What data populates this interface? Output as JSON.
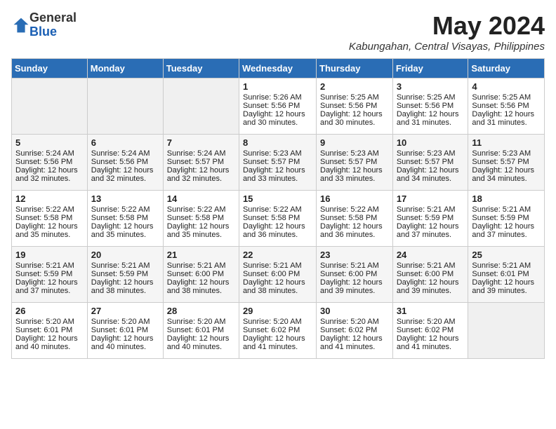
{
  "logo": {
    "general": "General",
    "blue": "Blue"
  },
  "title": "May 2024",
  "location": "Kabungahan, Central Visayas, Philippines",
  "days_header": [
    "Sunday",
    "Monday",
    "Tuesday",
    "Wednesday",
    "Thursday",
    "Friday",
    "Saturday"
  ],
  "weeks": [
    [
      {
        "day": "",
        "info": ""
      },
      {
        "day": "",
        "info": ""
      },
      {
        "day": "",
        "info": ""
      },
      {
        "day": "1",
        "info": "Sunrise: 5:26 AM\nSunset: 5:56 PM\nDaylight: 12 hours\nand 30 minutes."
      },
      {
        "day": "2",
        "info": "Sunrise: 5:25 AM\nSunset: 5:56 PM\nDaylight: 12 hours\nand 30 minutes."
      },
      {
        "day": "3",
        "info": "Sunrise: 5:25 AM\nSunset: 5:56 PM\nDaylight: 12 hours\nand 31 minutes."
      },
      {
        "day": "4",
        "info": "Sunrise: 5:25 AM\nSunset: 5:56 PM\nDaylight: 12 hours\nand 31 minutes."
      }
    ],
    [
      {
        "day": "5",
        "info": "Sunrise: 5:24 AM\nSunset: 5:56 PM\nDaylight: 12 hours\nand 32 minutes."
      },
      {
        "day": "6",
        "info": "Sunrise: 5:24 AM\nSunset: 5:56 PM\nDaylight: 12 hours\nand 32 minutes."
      },
      {
        "day": "7",
        "info": "Sunrise: 5:24 AM\nSunset: 5:57 PM\nDaylight: 12 hours\nand 32 minutes."
      },
      {
        "day": "8",
        "info": "Sunrise: 5:23 AM\nSunset: 5:57 PM\nDaylight: 12 hours\nand 33 minutes."
      },
      {
        "day": "9",
        "info": "Sunrise: 5:23 AM\nSunset: 5:57 PM\nDaylight: 12 hours\nand 33 minutes."
      },
      {
        "day": "10",
        "info": "Sunrise: 5:23 AM\nSunset: 5:57 PM\nDaylight: 12 hours\nand 34 minutes."
      },
      {
        "day": "11",
        "info": "Sunrise: 5:23 AM\nSunset: 5:57 PM\nDaylight: 12 hours\nand 34 minutes."
      }
    ],
    [
      {
        "day": "12",
        "info": "Sunrise: 5:22 AM\nSunset: 5:58 PM\nDaylight: 12 hours\nand 35 minutes."
      },
      {
        "day": "13",
        "info": "Sunrise: 5:22 AM\nSunset: 5:58 PM\nDaylight: 12 hours\nand 35 minutes."
      },
      {
        "day": "14",
        "info": "Sunrise: 5:22 AM\nSunset: 5:58 PM\nDaylight: 12 hours\nand 35 minutes."
      },
      {
        "day": "15",
        "info": "Sunrise: 5:22 AM\nSunset: 5:58 PM\nDaylight: 12 hours\nand 36 minutes."
      },
      {
        "day": "16",
        "info": "Sunrise: 5:22 AM\nSunset: 5:58 PM\nDaylight: 12 hours\nand 36 minutes."
      },
      {
        "day": "17",
        "info": "Sunrise: 5:21 AM\nSunset: 5:59 PM\nDaylight: 12 hours\nand 37 minutes."
      },
      {
        "day": "18",
        "info": "Sunrise: 5:21 AM\nSunset: 5:59 PM\nDaylight: 12 hours\nand 37 minutes."
      }
    ],
    [
      {
        "day": "19",
        "info": "Sunrise: 5:21 AM\nSunset: 5:59 PM\nDaylight: 12 hours\nand 37 minutes."
      },
      {
        "day": "20",
        "info": "Sunrise: 5:21 AM\nSunset: 5:59 PM\nDaylight: 12 hours\nand 38 minutes."
      },
      {
        "day": "21",
        "info": "Sunrise: 5:21 AM\nSunset: 6:00 PM\nDaylight: 12 hours\nand 38 minutes."
      },
      {
        "day": "22",
        "info": "Sunrise: 5:21 AM\nSunset: 6:00 PM\nDaylight: 12 hours\nand 38 minutes."
      },
      {
        "day": "23",
        "info": "Sunrise: 5:21 AM\nSunset: 6:00 PM\nDaylight: 12 hours\nand 39 minutes."
      },
      {
        "day": "24",
        "info": "Sunrise: 5:21 AM\nSunset: 6:00 PM\nDaylight: 12 hours\nand 39 minutes."
      },
      {
        "day": "25",
        "info": "Sunrise: 5:21 AM\nSunset: 6:01 PM\nDaylight: 12 hours\nand 39 minutes."
      }
    ],
    [
      {
        "day": "26",
        "info": "Sunrise: 5:20 AM\nSunset: 6:01 PM\nDaylight: 12 hours\nand 40 minutes."
      },
      {
        "day": "27",
        "info": "Sunrise: 5:20 AM\nSunset: 6:01 PM\nDaylight: 12 hours\nand 40 minutes."
      },
      {
        "day": "28",
        "info": "Sunrise: 5:20 AM\nSunset: 6:01 PM\nDaylight: 12 hours\nand 40 minutes."
      },
      {
        "day": "29",
        "info": "Sunrise: 5:20 AM\nSunset: 6:02 PM\nDaylight: 12 hours\nand 41 minutes."
      },
      {
        "day": "30",
        "info": "Sunrise: 5:20 AM\nSunset: 6:02 PM\nDaylight: 12 hours\nand 41 minutes."
      },
      {
        "day": "31",
        "info": "Sunrise: 5:20 AM\nSunset: 6:02 PM\nDaylight: 12 hours\nand 41 minutes."
      },
      {
        "day": "",
        "info": ""
      }
    ]
  ]
}
